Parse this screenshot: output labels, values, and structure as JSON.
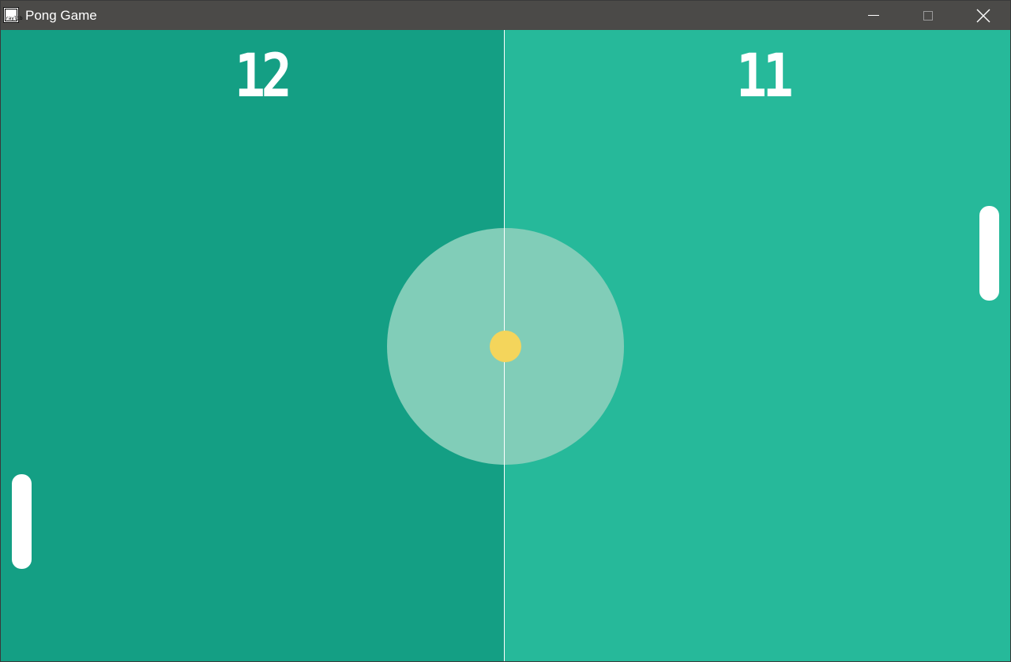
{
  "window": {
    "title": "Pong Game",
    "app_icon": {
      "name": "raylib-icon",
      "label": "raylib"
    }
  },
  "controls": {
    "minimize_icon": "minimize-icon",
    "maximize_icon": "maximize-icon",
    "close_icon": "close-icon"
  },
  "game": {
    "player_score": "12",
    "cpu_score": "11",
    "colors": {
      "left_field": "#149f84",
      "right_field": "#26b99a",
      "center_circle": "#81cdb8",
      "ball": "#f4d55b",
      "paddle": "#ffffff",
      "center_line": "#ffffff"
    }
  }
}
